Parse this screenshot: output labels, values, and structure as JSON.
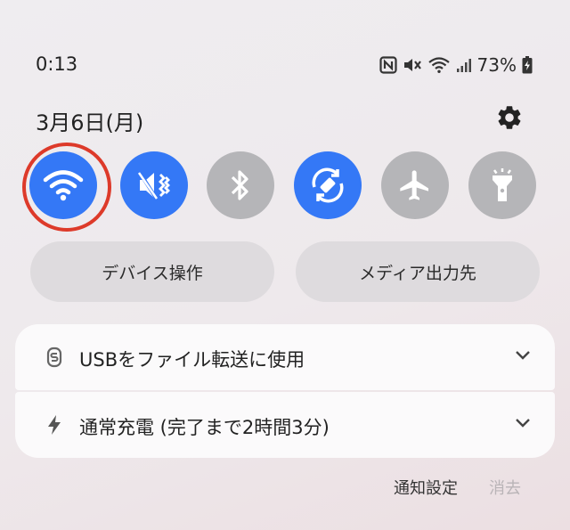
{
  "status_bar": {
    "time": "0:13",
    "battery": "73%",
    "icons": [
      "nfc-icon",
      "mute-icon",
      "wifi-icon",
      "signal-icon",
      "battery-charging-icon"
    ]
  },
  "header": {
    "date": "3月6日(月)",
    "settings_icon": "gear-icon"
  },
  "quick_settings": [
    {
      "name": "wifi",
      "icon": "wifi-icon",
      "state": "on"
    },
    {
      "name": "sound",
      "icon": "vibrate-icon",
      "state": "on"
    },
    {
      "name": "bluetooth",
      "icon": "bluetooth-icon",
      "state": "off"
    },
    {
      "name": "auto-rotate",
      "icon": "rotate-icon",
      "state": "on"
    },
    {
      "name": "airplane",
      "icon": "airplane-icon",
      "state": "off"
    },
    {
      "name": "flashlight",
      "icon": "flashlight-icon",
      "state": "off"
    }
  ],
  "controls": {
    "device_control": "デバイス操作",
    "media_output": "メディア出力先"
  },
  "notifications": [
    {
      "icon": "usb-icon",
      "title": "USBをファイル転送に使用"
    },
    {
      "icon": "charging-icon",
      "title": "通常充電 (完了まで2時間3分)"
    }
  ],
  "footer": {
    "notification_settings": "通知設定",
    "clear": "消去"
  },
  "colors": {
    "accent": "#3478f6",
    "tile_off": "#b5b5b8",
    "highlight": "#dd3a2a"
  }
}
